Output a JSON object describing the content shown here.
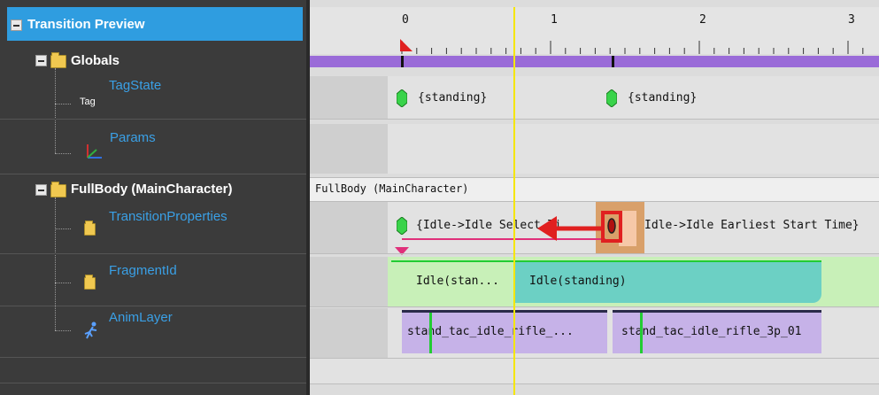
{
  "tree": {
    "root": {
      "label": "Transition Preview"
    },
    "groups": [
      {
        "label": "Globals"
      },
      {
        "label": "FullBody (MainCharacter)"
      }
    ],
    "leaves": [
      {
        "label": "TagState",
        "badge": "Tag"
      },
      {
        "label": "Params"
      },
      {
        "label": "TransitionProperties"
      },
      {
        "label": "FragmentId"
      },
      {
        "label": "AnimLayer"
      }
    ]
  },
  "timeline": {
    "ruler_labels": [
      "0",
      "1",
      "2",
      "3"
    ],
    "playhead_time": 0.75,
    "tagstate_events": [
      {
        "label": "{standing}"
      },
      {
        "label": "{standing}"
      }
    ],
    "fullbody_header": "FullBody (MainCharacter)",
    "transition_events": [
      {
        "label": "{Idle->Idle Select Ti..."
      },
      {
        "label": "Idle->Idle Earliest Start Time}"
      }
    ],
    "fragments": [
      {
        "label": "Idle(stan..."
      },
      {
        "label": "Idle(standing)"
      }
    ],
    "anims": [
      {
        "label": "stand_tac_idle_rifle_..."
      },
      {
        "label": "stand_tac_idle_rifle_3p_01"
      }
    ],
    "colors": {
      "purple_bar": "#9a6bd8",
      "fragment_green": "#c8f0b8",
      "fragment_teal": "#6cd0c4",
      "anim_purple": "#c6b2e8",
      "highlight_red": "#e02020",
      "playhead_yellow": "#f5e600"
    }
  }
}
